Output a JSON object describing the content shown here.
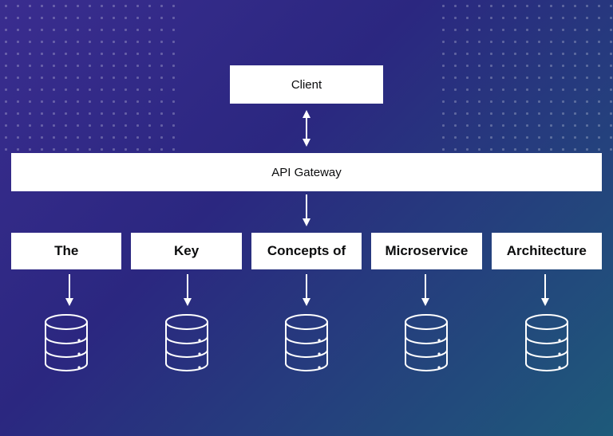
{
  "client": {
    "label": "Client"
  },
  "gateway": {
    "label": "API Gateway"
  },
  "services": [
    {
      "label": "The"
    },
    {
      "label": "Key"
    },
    {
      "label": "Concepts of"
    },
    {
      "label": "Microservice"
    },
    {
      "label": "Architecture"
    }
  ]
}
